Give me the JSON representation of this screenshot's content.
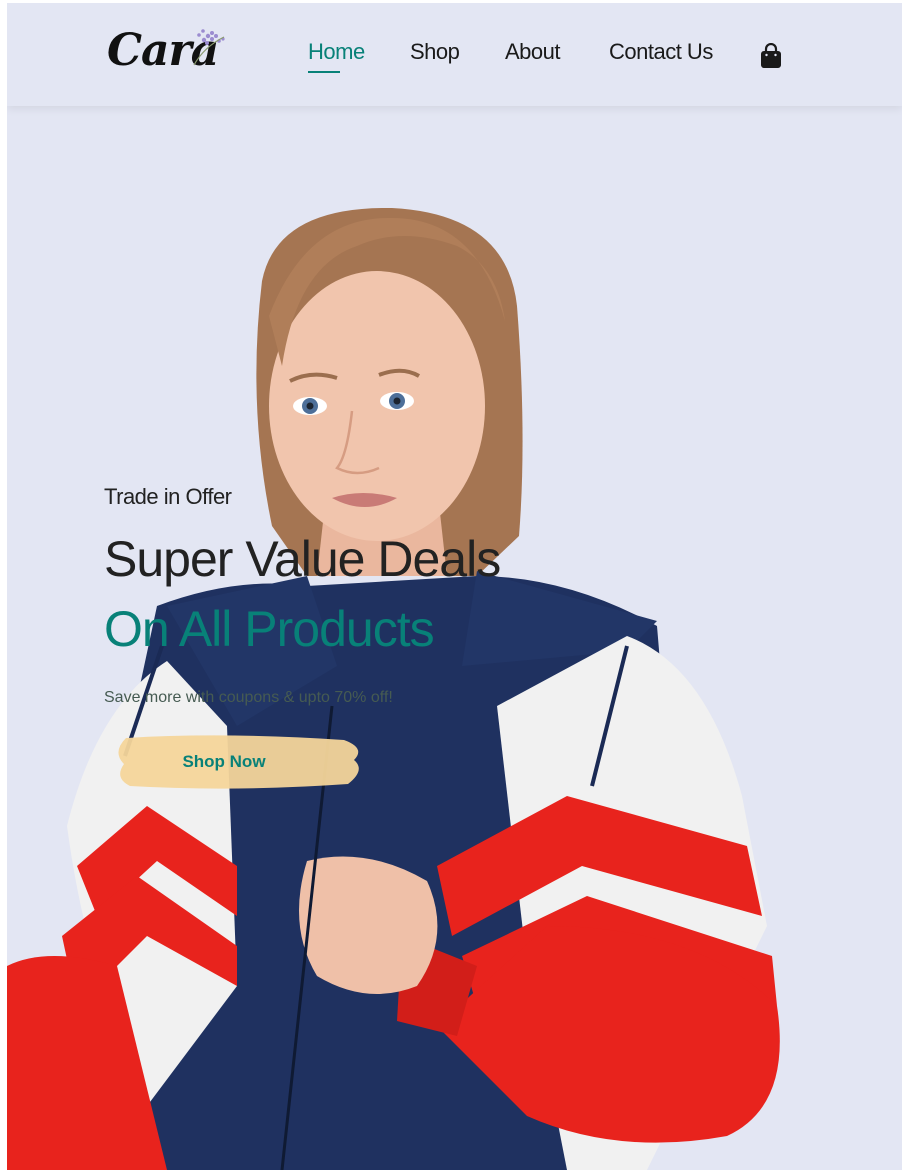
{
  "header": {
    "logo_text": "Cara",
    "nav": [
      {
        "label": "Home",
        "active": true
      },
      {
        "label": "Shop",
        "active": false
      },
      {
        "label": "About",
        "active": false
      },
      {
        "label": "Contact Us",
        "active": false
      }
    ],
    "cart_icon": "shopping-bag-icon"
  },
  "hero": {
    "kicker": "Trade in Offer",
    "headline": "Super Value Deals",
    "subheadline": "On All Products",
    "tagline": "Save more with coupons & upto 70% off!",
    "cta_label": "Shop Now"
  },
  "colors": {
    "accent": "#088178",
    "background": "#e3e6f3",
    "text": "#222222",
    "button_bg": "#f4d59a"
  }
}
